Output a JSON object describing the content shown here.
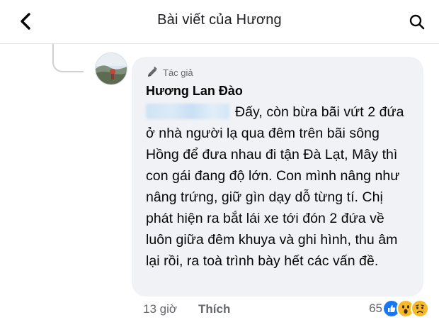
{
  "header": {
    "title": "Bài viết của Hương",
    "back_icon": "chevron-left-icon",
    "search_icon": "search-icon"
  },
  "comment": {
    "badge_label": "Tác giả",
    "badge_icon": "pencil-icon",
    "author_name": "Hương Lan Đào",
    "mention_blurred": true,
    "text": "Đấy, còn bừa bãi vứt 2 đứa ở nhà người lạ qua đêm trên bãi sông Hồng để đưa nhau đi tận Đà Lạt, Mây thì con gái đang độ lớn. Con mình nâng như nâng trứng, giữ gìn dạy dỗ từng tí. Chị phát hiện ra bắt lái xe tới đón 2 đứa về luôn giữa đêm khuya và ghi hình, thu âm lại rồi, ra toà trình bày hết các vấn đề.",
    "timestamp": "13 giờ",
    "like_label": "Thích",
    "reaction_count": "65",
    "reactions": [
      "like-icon",
      "wow-icon",
      "sad-icon"
    ]
  },
  "colors": {
    "bubble_bg": "#f0f2f5",
    "secondary_text": "#65676b",
    "like_blue": "#1877f2",
    "emoji_yellow": "#f7b928"
  }
}
